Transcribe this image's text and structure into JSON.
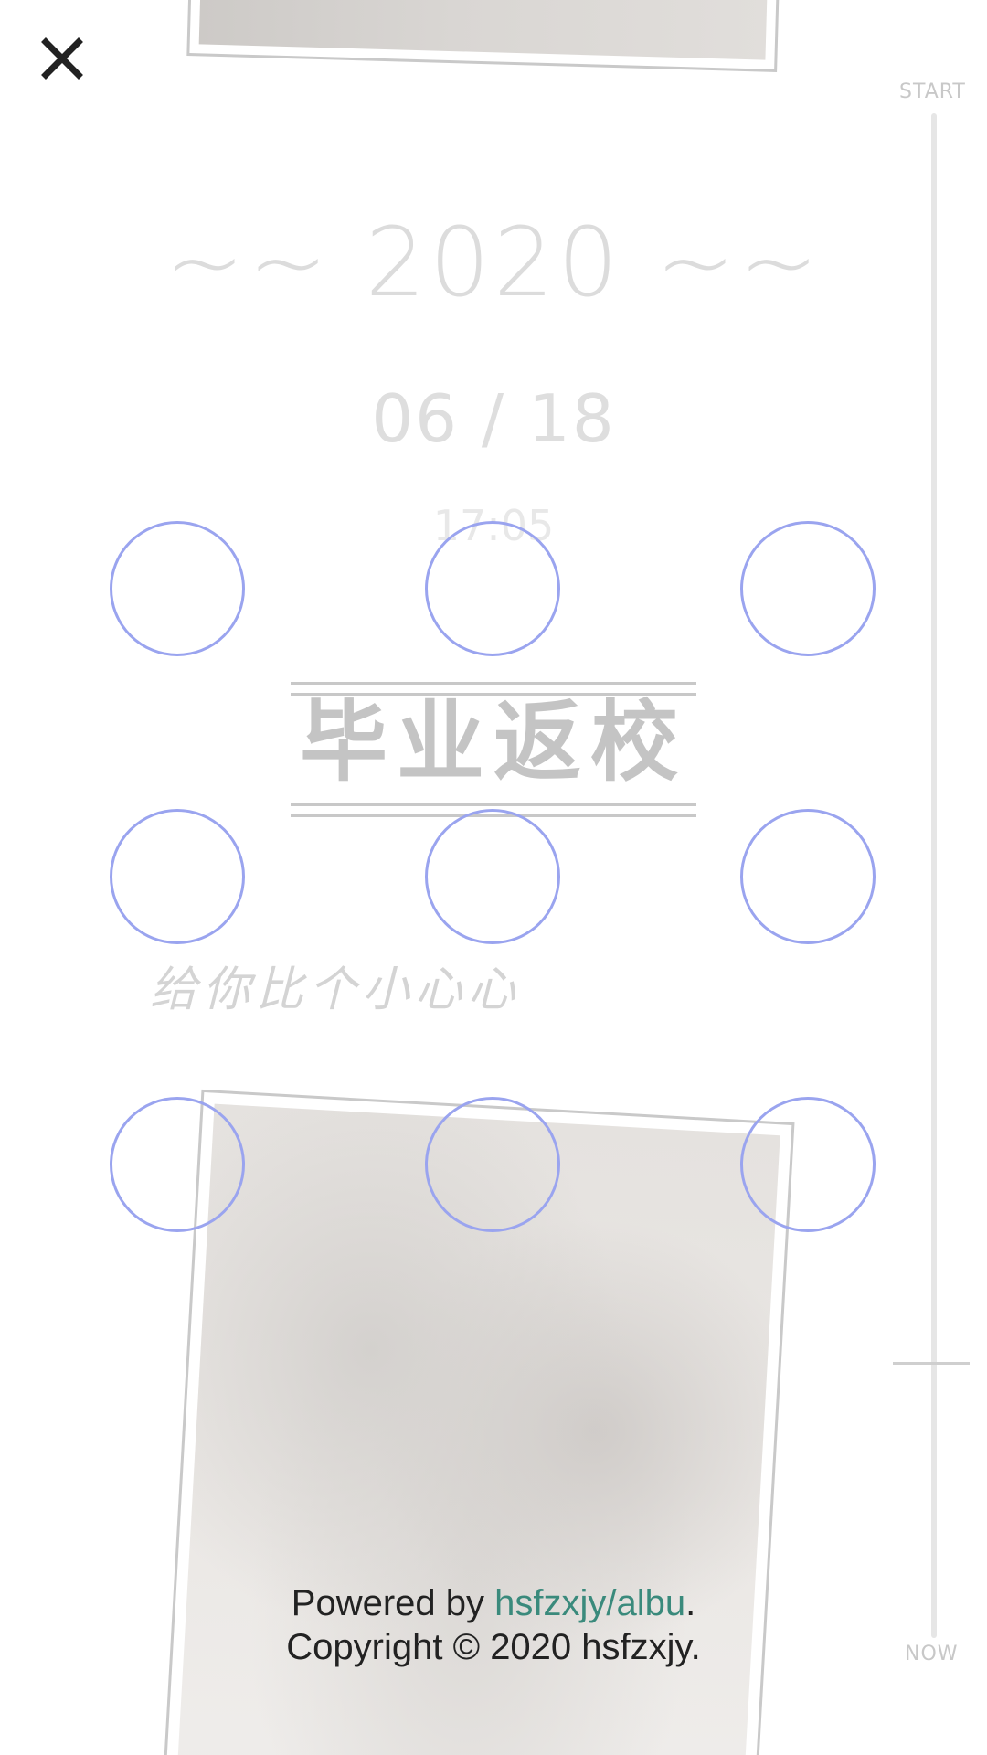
{
  "date": {
    "year": "~~ 2020 ~~",
    "month_day": "06 / 18",
    "time": "17:05"
  },
  "title": "毕业返校",
  "subtitle": "给你比个小心心",
  "timeline": {
    "start_label": "START",
    "now_label": "NOW"
  },
  "footer": {
    "powered_prefix": "Powered by ",
    "link_text": "hsfzxjy/albu",
    "powered_suffix": ".",
    "copyright": "Copyright © 2020 hsfzxjy."
  },
  "icons": {
    "close": "close-icon"
  },
  "colors": {
    "lock_circle": "#9aa4ef",
    "link": "#3a8a7c",
    "text_dark": "#222222",
    "faded_text": "#dcdcdc"
  }
}
